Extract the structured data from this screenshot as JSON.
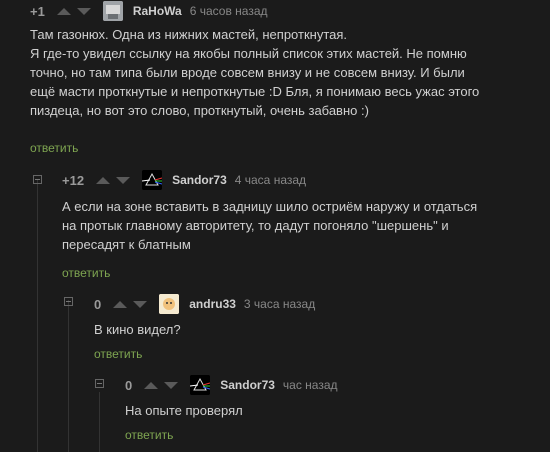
{
  "comments": [
    {
      "rating": "+1",
      "nick": "RaHoWa",
      "time": "6 часов назад",
      "lines": [
        "Там газонюх. Одна из нижних мастей, непроткнутая.",
        "Я где-то увидел ссылку на якобы полный список этих мастей. Не помню",
        "точно, но там типа были вроде совсем внизу и не совсем внизу. И были",
        "ещё масти проткнутые и непроткнутые :D Бля, я понимаю весь ужас этого",
        "пиздеца, но вот это слово, проткнутый, очень забавно :)"
      ],
      "reply": "ответить"
    },
    {
      "rating": "+12",
      "nick": "Sandor73",
      "time": "4 часа назад",
      "lines": [
        "А если на зоне вставить в задницу шило остриём наружу и отдаться",
        "на протык главному авторитету, то дадут погоняло \"шершень\" и",
        "пересадят к блатным"
      ],
      "reply": "ответить"
    },
    {
      "rating": "0",
      "nick": "andru33",
      "time": "3 часа назад",
      "lines": [
        "В кино видел?"
      ],
      "reply": "ответить"
    },
    {
      "rating": "0",
      "nick": "Sandor73",
      "time": "час назад",
      "lines": [
        "На опыте проверял"
      ],
      "reply": "ответить"
    }
  ],
  "colors": {
    "accent": "#7fa651",
    "background": "#1b1b1b",
    "text": "#d0d0d0",
    "muted": "#888888"
  }
}
